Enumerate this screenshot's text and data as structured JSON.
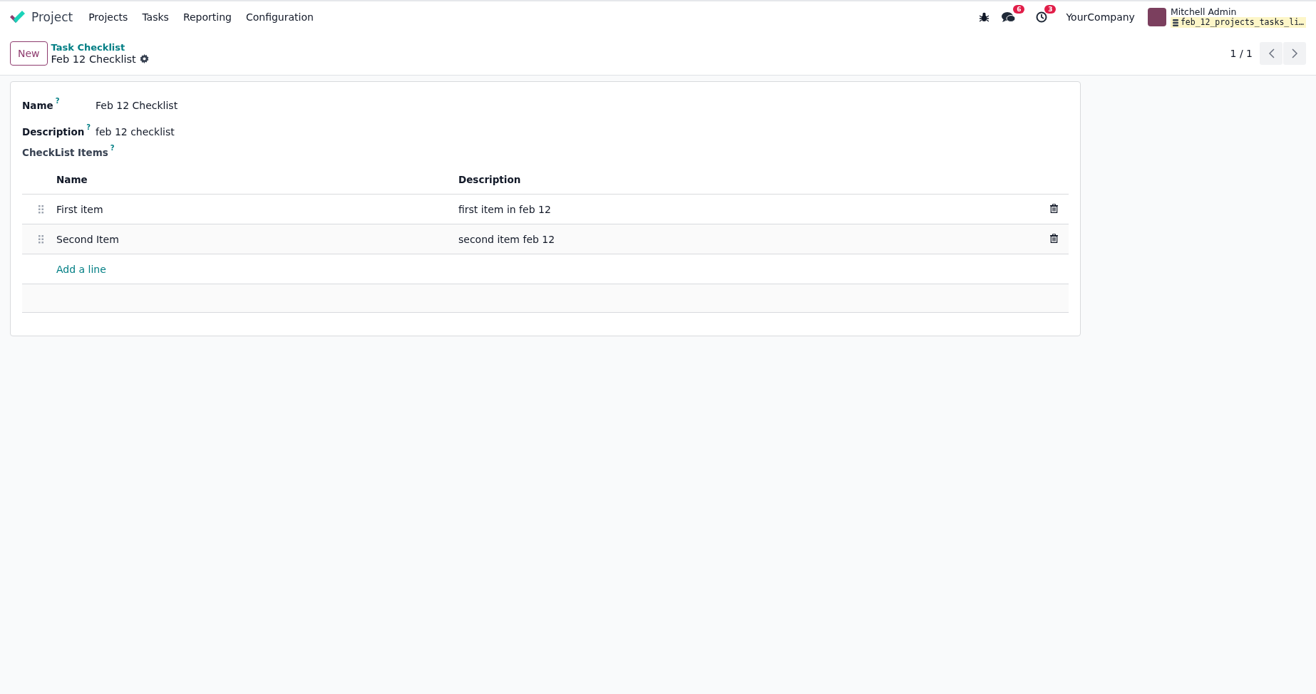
{
  "app": {
    "name": "Project"
  },
  "menu": [
    "Projects",
    "Tasks",
    "Reporting",
    "Configuration"
  ],
  "systray": {
    "messages_count": "6",
    "activities_count": "3",
    "company": "YourCompany",
    "user": "Mitchell Admin",
    "database": "feb_12_projects_tasks_li…"
  },
  "control_panel": {
    "new_button": "New",
    "breadcrumb": "Task Checklist",
    "record_title": "Feb 12 Checklist",
    "pager": "1 / 1"
  },
  "form": {
    "fields": [
      {
        "label": "Name",
        "help": "?",
        "value": "Feb 12 Checklist"
      },
      {
        "label": "Description",
        "help": "?",
        "value": "feb 12 checklist"
      }
    ],
    "checklist": {
      "label": "CheckList Items",
      "help": "?",
      "columns": [
        "Name",
        "Description"
      ],
      "rows": [
        {
          "name": "First item",
          "description": "first item in feb 12"
        },
        {
          "name": "Second Item",
          "description": "second item feb 12"
        }
      ],
      "add_line": "Add a line"
    }
  }
}
